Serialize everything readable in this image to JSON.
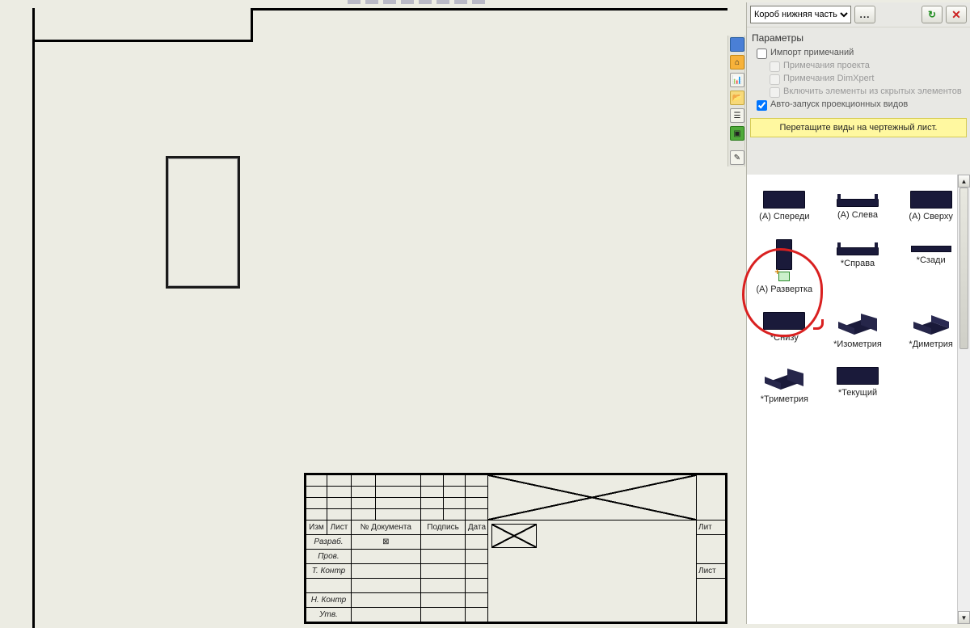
{
  "top_toolbar": [
    "zoom",
    "pan",
    "rotate",
    "fit",
    "shaded",
    "section",
    "measure",
    "markup"
  ],
  "dropdown": {
    "selected": "Короб нижняя часть"
  },
  "params_title": "Параметры",
  "import_notes": "Импорт примечаний",
  "sub_checks": {
    "project_notes": "Примечания проекта",
    "dimxpert_notes": "Примечания DimXpert",
    "hidden_elems": "Включить элементы из скрытых элементов"
  },
  "auto_launch": "Авто-запуск проекционных видов",
  "drag_hint": "Перетащите виды на чертежный лист.",
  "views": [
    {
      "label": "(A) Спереди",
      "style": "flat"
    },
    {
      "label": "(A) Слева",
      "style": "channel"
    },
    {
      "label": "(A) Сверху",
      "style": "flat"
    },
    {
      "label": "(A) Развертка",
      "style": "tall_flat"
    },
    {
      "label": "*Справа",
      "style": "channel"
    },
    {
      "label": "*Сзади",
      "style": "line"
    },
    {
      "label": "*Снизу",
      "style": "flat"
    },
    {
      "label": "*Изометрия",
      "style": "iso_open"
    },
    {
      "label": "*Диметрия",
      "style": "iso_closed"
    },
    {
      "label": "*Триметрия",
      "style": "iso_open"
    },
    {
      "label": "*Текущий",
      "style": "flat"
    }
  ],
  "titleblock": {
    "headers": {
      "izm": "Изм",
      "list": "Лист",
      "doc": "№ Документа",
      "sign": "Подпись",
      "date": "Дата",
      "lit": "Лит",
      "list_right": "Лист"
    },
    "roles": {
      "razrab": "Разраб.",
      "prov": "Пров.",
      "tkontr": "Т. Контр",
      "nkontr": "Н. Контр",
      "utv": "Утв."
    }
  },
  "side_buttons": [
    "display-states",
    "home",
    "stats",
    "folder",
    "tree",
    "view-selector",
    "commands"
  ]
}
